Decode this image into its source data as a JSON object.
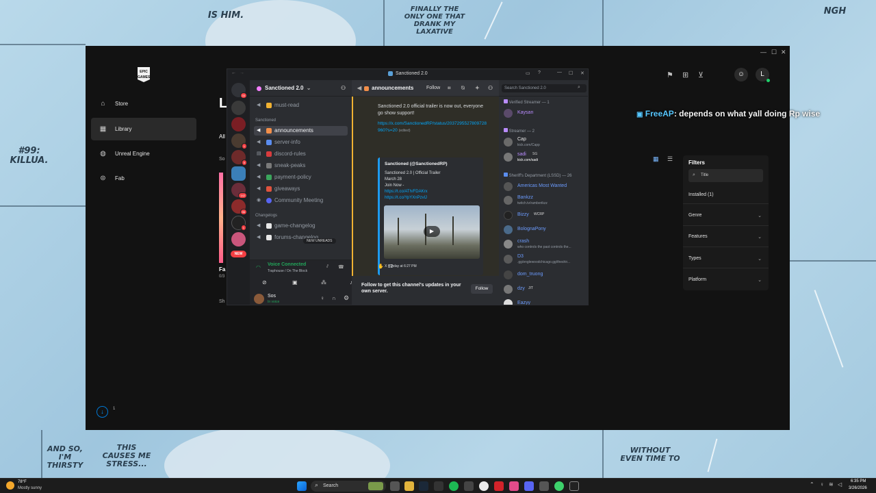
{
  "wallpaper": {
    "texts": [
      "IS HIM.",
      "FINALLY THE ONLY ONE THAT DRANK MY LAXATIVE",
      "NGH",
      "#99: KILLUA.",
      "AND SO, I'M THIRSTY",
      "THIS CAUSES ME STRESS...",
      "WITHOUT EVEN TIME TO"
    ]
  },
  "epic": {
    "logo_text": "EPIC GAMES",
    "nav": [
      {
        "label": "Store",
        "icon": "tag-icon"
      },
      {
        "label": "Library",
        "icon": "grid-icon"
      },
      {
        "label": "Unreal Engine",
        "icon": "unreal-icon"
      },
      {
        "label": "Fab",
        "icon": "fab-icon"
      }
    ],
    "avatar_initial": "L",
    "page_title_partial": "L",
    "tab_partial": "All",
    "sort_partial": "So",
    "game_title_partial": "Fa",
    "game_sub_partial": "0/3",
    "show_partial": "Sh",
    "filters": {
      "title": "Filters",
      "search_placeholder": "Title",
      "installed": "Installed (1)",
      "rows": [
        "Genre",
        "Features",
        "Types",
        "Platform"
      ]
    },
    "downloads_badge": "1"
  },
  "discord": {
    "window_title": "Sanctioned 2.0",
    "server_name": "Sanctioned 2.0",
    "server_badges": [
      "33",
      "1",
      "5",
      "142",
      "96",
      "1"
    ],
    "new_badge": "NEW",
    "channels_top": [
      {
        "name": "must-read",
        "active": false
      }
    ],
    "category_1": "Sanctioned",
    "channels_main": [
      {
        "name": "announcements",
        "active": true
      },
      {
        "name": "server-info",
        "active": false
      },
      {
        "name": "discord-rules",
        "active": false
      },
      {
        "name": "sneak-peaks",
        "active": false
      },
      {
        "name": "payment-policy",
        "active": false
      },
      {
        "name": "giveaways",
        "active": false
      },
      {
        "name": "Community Meeting",
        "active": false
      }
    ],
    "category_2": "Changelogs",
    "channels_changelog": [
      {
        "name": "game-changelog",
        "active": false
      },
      {
        "name": "forums-changelog",
        "active": false
      }
    ],
    "new_unreads": "NEW UNREADS",
    "voice": {
      "status": "Voice Connected",
      "location": "Traphouse / On The Block"
    },
    "user": {
      "name": "Sos",
      "status": "In voice"
    },
    "channel_header": "announcements",
    "follow_label": "Follow",
    "message": {
      "text": "Sanctioned 2.0 official trailer is now out, everyone go show support!",
      "link": "https://x.com/SanctionedRP/status/2037295527809728960?s=20",
      "edited": "(edited)",
      "embed": {
        "author": "Sanctioned (@SanctionedRP)",
        "line1": "Sanctioned 2.0 | Official Trailer",
        "line2": "March 28",
        "line3": "Join Now -",
        "link1": "https://t.co/ATh/FDAKrx",
        "link2": "https://t.co/YpYXnPzvlJ",
        "footer": "X • Today at 6:27 PM"
      },
      "reaction_count": "32"
    },
    "follow_prompt": "Follow to get this channel's updates in your own server.",
    "follow_button": "Follow",
    "member_search_placeholder": "Search Sanctioned 2.0",
    "member_groups": [
      {
        "label": "Verified Streamer — 1",
        "members": [
          {
            "name": "Kaysan",
            "sub": "",
            "color": "#b98cff"
          }
        ]
      },
      {
        "label": "Streamer — 2",
        "members": [
          {
            "name": "Cap",
            "sub": "kick.com/Capp",
            "color": "#e6e6e6"
          },
          {
            "name": "sadi",
            "sub": "kick.com/sadi",
            "color": "#b98cff",
            "tag": "SG"
          }
        ]
      },
      {
        "label": "Sheriff's Department (LSSD) — 26",
        "members": [
          {
            "name": "Americas Most Wanted",
            "sub": "",
            "color": "#6c9cff"
          },
          {
            "name": "Bankzz",
            "sub": "twitch.tv/ramberikzz",
            "color": "#6c9cff"
          },
          {
            "name": "Bizzy",
            "sub": "",
            "color": "#6c9cff",
            "tag": "WCRP"
          },
          {
            "name": "BolognaPony",
            "sub": "",
            "color": "#6c9cff"
          },
          {
            "name": "crash",
            "sub": "who controls the past controls the...",
            "color": "#6c9cff"
          },
          {
            "name": "D3",
            "sub": ".gg/englewoodchicago.gg/theshir...",
            "color": "#6c9cff"
          },
          {
            "name": "dom_truong",
            "sub": "",
            "color": "#6c9cff"
          },
          {
            "name": "dzy",
            "sub": "",
            "color": "#6c9cff",
            "tag": "JIT"
          },
          {
            "name": "Eazyy",
            "sub": "",
            "color": "#6c9cff"
          }
        ]
      }
    ]
  },
  "overlay_chat": {
    "user": "FreeAP",
    "text": ": depends on what yall doing Rp wise"
  },
  "taskbar": {
    "weather_temp": "78°F",
    "weather_desc": "Mostly sunny",
    "search_label": "Search",
    "time": "6:35 PM",
    "date": "3/26/2026"
  }
}
